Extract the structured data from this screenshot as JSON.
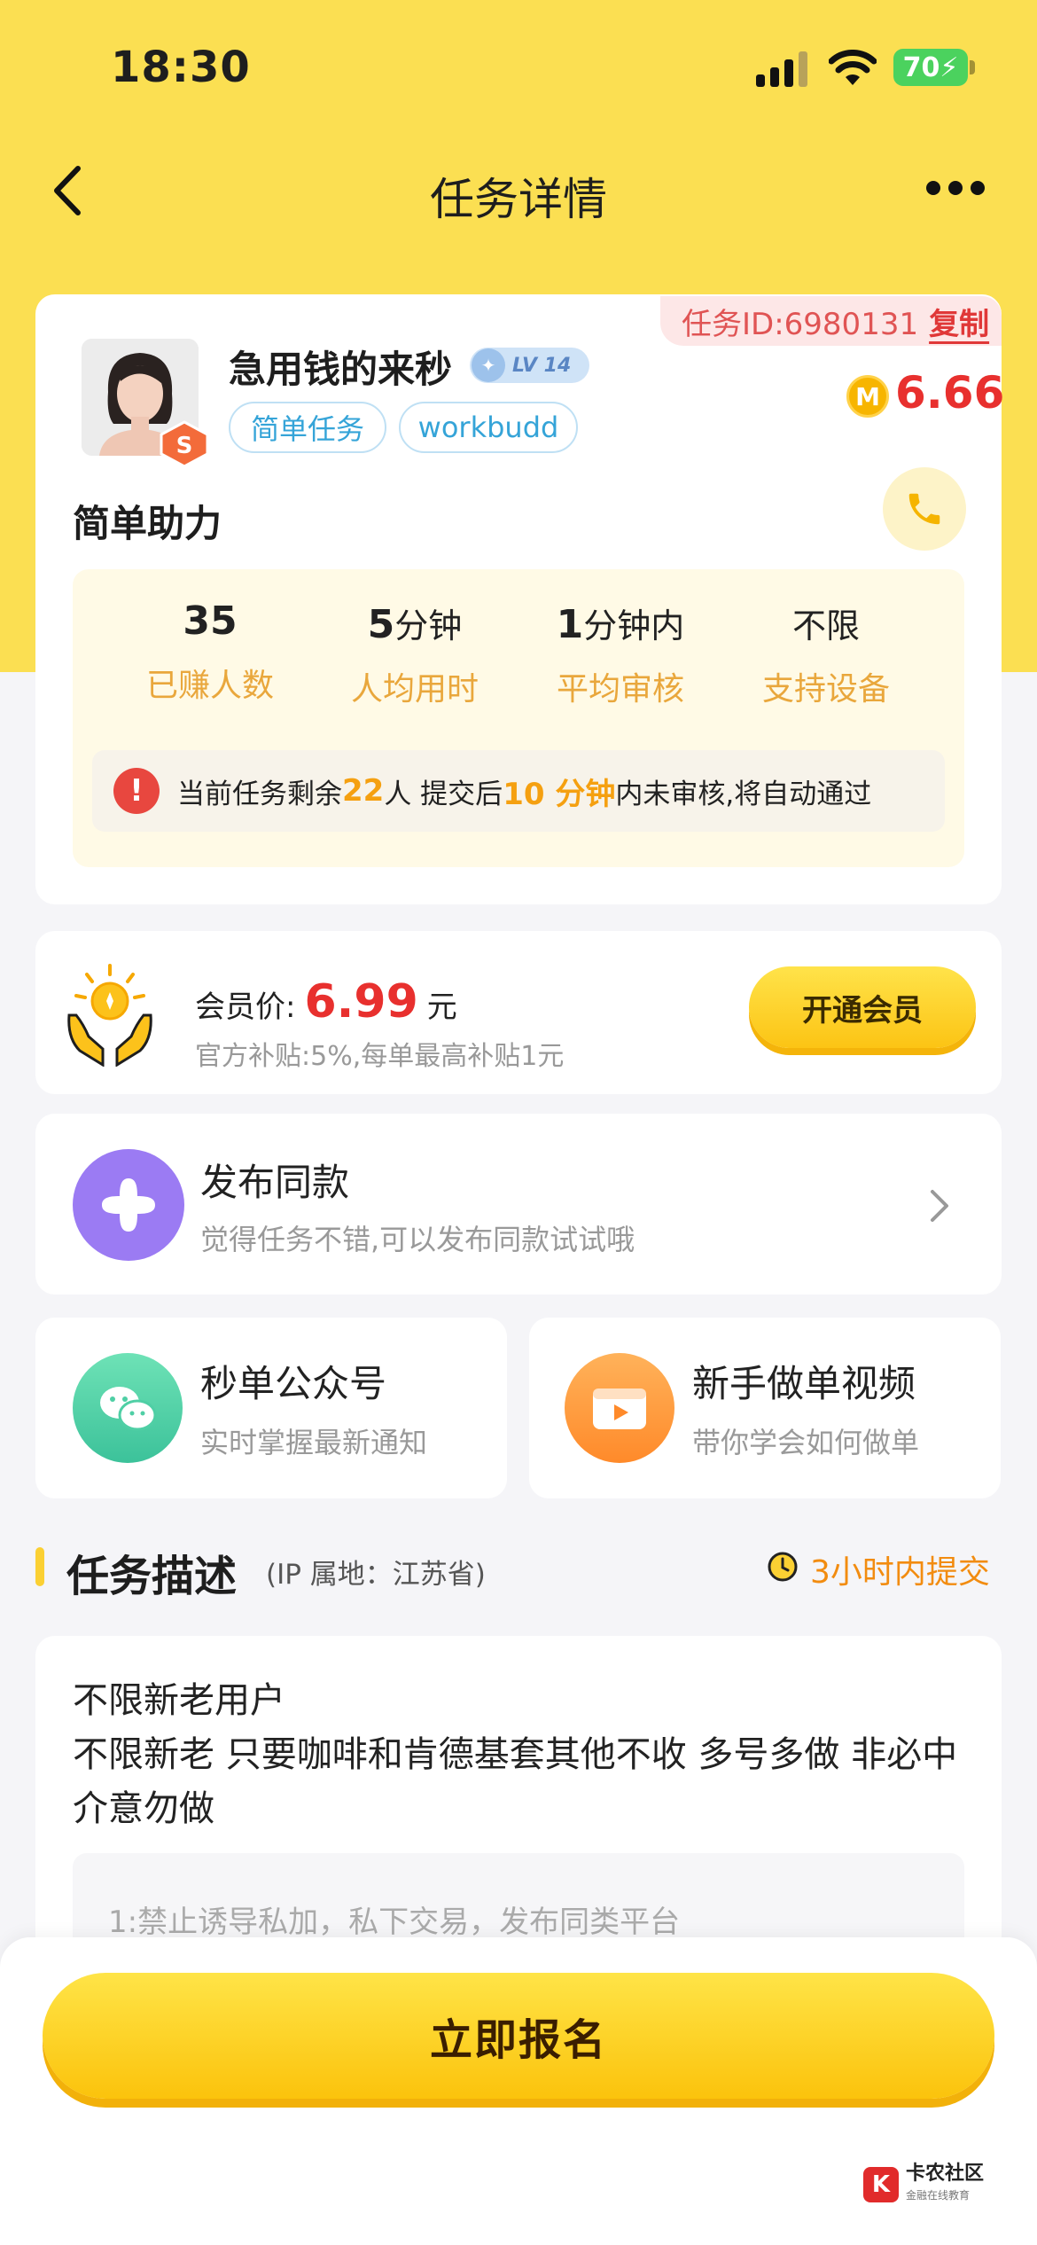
{
  "status_bar": {
    "time": "18:30",
    "battery": "70"
  },
  "nav": {
    "title": "任务详情"
  },
  "task": {
    "id_label": "任务ID:6980131",
    "copy_label": "复制",
    "publisher": "急用钱的来秒",
    "level": "LV 14",
    "tags": [
      "简单任务",
      "workbudd"
    ],
    "reward": "6.66",
    "coin_glyph": "M",
    "name": "简单助力",
    "stats": [
      {
        "value": "35",
        "unit": "",
        "label": "已赚人数"
      },
      {
        "value": "5",
        "unit": "分钟",
        "label": "人均用时"
      },
      {
        "value": "1",
        "unit": "分钟内",
        "label": "平均审核"
      },
      {
        "value": "",
        "unit": "不限",
        "label": "支持设备"
      }
    ],
    "notice": {
      "prefix": "当前任务剩余",
      "remaining": "22",
      "mid": "人 提交后",
      "minutes": "10 分钟",
      "suffix": "内未审核,将自动通过"
    }
  },
  "member": {
    "label": "会员价:",
    "price": "6.99",
    "unit": "元",
    "subsidy": "官方补贴:5%,每单最高补贴1元",
    "button": "开通会员"
  },
  "publish_same": {
    "title": "发布同款",
    "subtitle": "觉得任务不错,可以发布同款试试哦"
  },
  "official_account": {
    "title": "秒单公众号",
    "subtitle": "实时掌握最新通知"
  },
  "tutorial_video": {
    "title": "新手做单视频",
    "subtitle": "带你学会如何做单"
  },
  "description": {
    "title": "任务描述",
    "ip": "(IP 属地：江苏省)",
    "deadline": "3小时内提交",
    "text_line1": "不限新老用户",
    "text_line2": "不限新老 只要咖啡和肯德基套其他不收 多号多做 非必中介意勿做",
    "rule1": "1:禁止诱导私加，私下交易，发布同类平台"
  },
  "cta": {
    "label": "立即报名"
  },
  "watermark": {
    "name": "卡农社区",
    "sub": "金融在线教育"
  },
  "colors": {
    "accent_yellow": "#fbdf52",
    "price_red": "#e8302e",
    "highlight_orange": "#f5a010"
  }
}
